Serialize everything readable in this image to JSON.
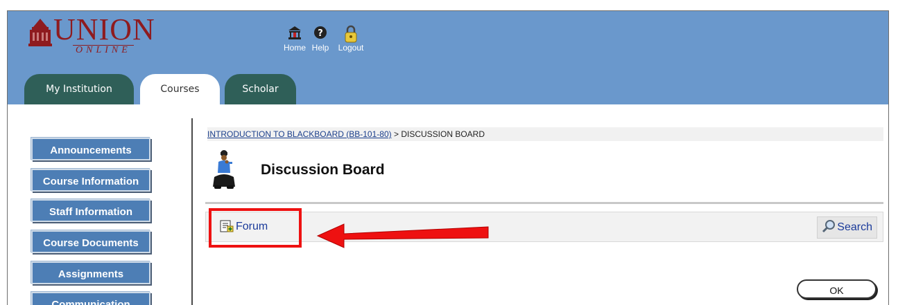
{
  "logo": {
    "word": "UNION",
    "sub": "ONLINE"
  },
  "toplinks": [
    {
      "label": "Home",
      "icon": "home-icon"
    },
    {
      "label": "Help",
      "icon": "help-icon"
    },
    {
      "label": "Logout",
      "icon": "padlock-icon"
    }
  ],
  "tabs": [
    {
      "label": "My Institution",
      "active": false
    },
    {
      "label": "Courses",
      "active": true
    },
    {
      "label": "Scholar",
      "active": false
    }
  ],
  "sidebar": {
    "items": [
      {
        "label": "Announcements"
      },
      {
        "label": "Course Information"
      },
      {
        "label": "Staff Information"
      },
      {
        "label": "Course Documents"
      },
      {
        "label": "Assignments"
      },
      {
        "label": "Communication"
      }
    ]
  },
  "breadcrumb": {
    "course_link": "INTRODUCTION TO BLACKBOARD (BB-101-80)",
    "separator": " > ",
    "current": "DISCUSSION BOARD"
  },
  "page": {
    "title": "Discussion Board",
    "icon": "discussion-person-icon"
  },
  "actionbar": {
    "forum_label": "Forum",
    "forum_icon": "add-forum-icon",
    "search_label": "Search",
    "search_icon": "magnifier-icon"
  },
  "annotation": {
    "color": "#ee1111",
    "target": "Forum"
  },
  "footer": {
    "ok_label": "OK"
  },
  "colors": {
    "header_bg": "#6a98cc",
    "tab_dark": "#2f5f58",
    "nav_button": "#4d7eb5",
    "link": "#1a3e8b"
  }
}
